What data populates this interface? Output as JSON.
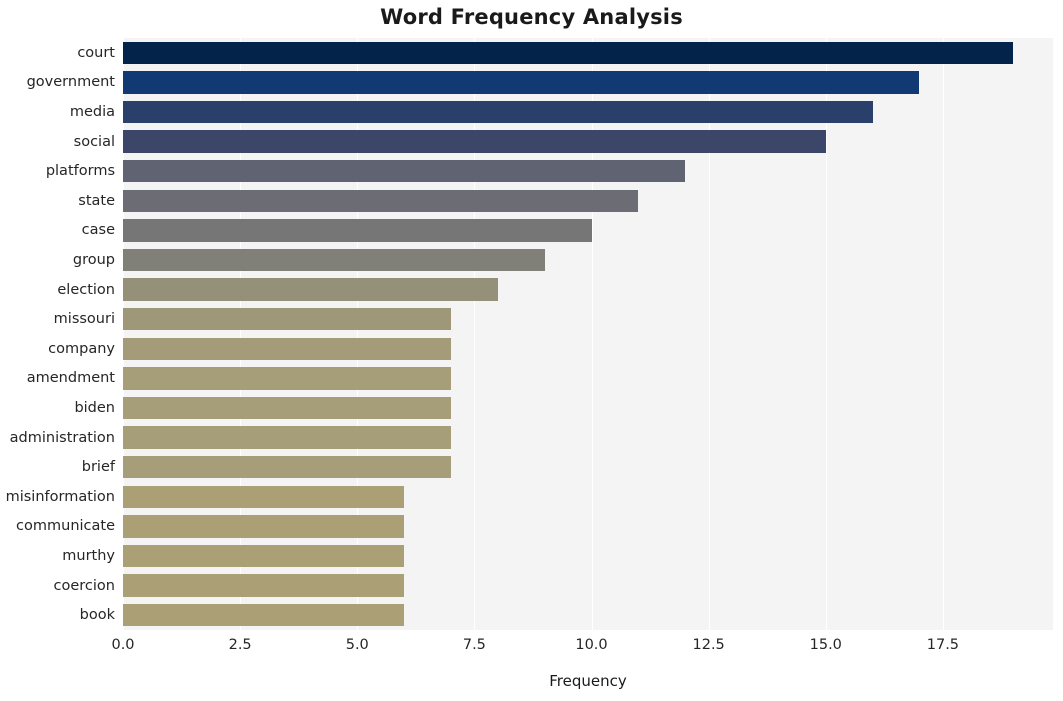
{
  "chart_data": {
    "type": "bar",
    "orientation": "horizontal",
    "title": "Word Frequency Analysis",
    "xlabel": "Frequency",
    "ylabel": "",
    "categories": [
      "court",
      "government",
      "media",
      "social",
      "platforms",
      "state",
      "case",
      "group",
      "election",
      "missouri",
      "company",
      "amendment",
      "biden",
      "administration",
      "brief",
      "misinformation",
      "communicate",
      "murthy",
      "coercion",
      "book"
    ],
    "values": [
      19,
      17,
      16,
      15,
      12,
      11,
      10,
      9,
      8,
      7,
      7,
      7,
      7,
      7,
      7,
      6,
      6,
      6,
      6,
      6
    ],
    "bar_colors": [
      "#04234a",
      "#113a75",
      "#2b3f6b",
      "#3b4668",
      "#5f6372",
      "#6c6d74",
      "#767676",
      "#818078",
      "#959078",
      "#9f9878",
      "#a49c78",
      "#a69e78",
      "#a69e78",
      "#a69e78",
      "#a69e78",
      "#ab9f76",
      "#ab9f76",
      "#ab9f76",
      "#ab9f76",
      "#ab9f76"
    ],
    "xlim": [
      0,
      19.85
    ],
    "xticks": [
      0.0,
      2.5,
      5.0,
      7.5,
      10.0,
      12.5,
      15.0,
      17.5
    ],
    "xticklabels": [
      "0.0",
      "2.5",
      "5.0",
      "7.5",
      "10.0",
      "12.5",
      "15.0",
      "17.5"
    ],
    "grid": true,
    "grid_color": "#ffffff",
    "plot_background": "#f4f4f4",
    "figure_background": "#ffffff",
    "legend": null
  }
}
